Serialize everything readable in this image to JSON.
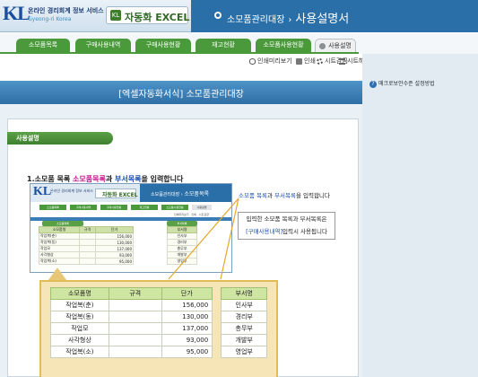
{
  "header": {
    "logo_mark": "KL",
    "logo_line1": "온라인 경리회계 정보 서비스",
    "logo_line2": "Gyeong-ri Korea",
    "product_name": "자동화 EXCEL",
    "breadcrumb_parent": "소모품관리대장",
    "breadcrumb_current": "사용설명서"
  },
  "tabs": [
    {
      "label": "소모품목록"
    },
    {
      "label": "구매사용내역"
    },
    {
      "label": "구매사용현황"
    },
    {
      "label": "재고현황"
    },
    {
      "label": "소모품사용현황"
    },
    {
      "label": "사용설명",
      "active": true
    }
  ],
  "toolbar": [
    {
      "label": "인쇄미리보기",
      "icon": "preview-icon"
    },
    {
      "label": "인쇄",
      "icon": "print-icon"
    },
    {
      "label": "시트감금",
      "icon": "lock-sheet-icon"
    },
    {
      "label": "시트해제",
      "icon": "unlock-sheet-icon"
    }
  ],
  "sidebar": {
    "help_label": "매크로보안수준 설정방법"
  },
  "banner": {
    "title": "[엑셀자동화서식] 소모품관리대장"
  },
  "section": {
    "title": "사용설명"
  },
  "step1": {
    "prefix": "1.소모품 목록",
    "pink": "소모품목록",
    "conj": "과",
    "blue": "부서목록",
    "suffix": "을 입력합니다"
  },
  "mini": {
    "logo_mark": "KL",
    "logo_text": "온라인 경리회계 정보 서비스",
    "product_name": "자동화 EXCEL",
    "breadcrumb_parent": "소모품관리대장",
    "breadcrumb_current": "소모품목록",
    "tabs": [
      "소모품목록",
      "구매사용내역",
      "구매사용현황",
      "재고현황",
      "소모품사용현황",
      "사용설명"
    ],
    "tools": "인쇄미리보기 · 인쇄 · 시트감금",
    "caption_left": "소모품목록",
    "caption_right": "부서목록",
    "headers": [
      "소모품명",
      "규격",
      "단가"
    ],
    "rows": [
      {
        "name": "작업복(춘)",
        "spec": "",
        "price": "156,000"
      },
      {
        "name": "작업복(동)",
        "spec": "",
        "price": "130,000"
      },
      {
        "name": "작업모",
        "spec": "",
        "price": "137,000"
      },
      {
        "name": "사각형상",
        "spec": "",
        "price": "93,000"
      },
      {
        "name": "작업복(소)",
        "spec": "",
        "price": "95,000"
      }
    ],
    "dept_header": "부서명",
    "depts": [
      "인사부",
      "경리부",
      "총무부",
      "개발부",
      "영업부"
    ]
  },
  "notes": {
    "note1_blue1": "소모품 목록",
    "note1_mid": "과 ",
    "note1_blue2": "부서목록",
    "note1_end": "을 입력합니다",
    "note2_line1": "입력한 소모품 목록과 부서목록은",
    "note2_line2_blue": "[구매사용내역]",
    "note2_line2_rest": "입력시 사용됩니다"
  },
  "zoom": {
    "headers": [
      "소모품명",
      "규격",
      "단가"
    ],
    "rows": [
      {
        "name": "작업복(춘)",
        "spec": "",
        "price": "156,000"
      },
      {
        "name": "작업복(동)",
        "spec": "",
        "price": "130,000"
      },
      {
        "name": "작업모",
        "spec": "",
        "price": "137,000"
      },
      {
        "name": "사각형상",
        "spec": "",
        "price": "93,000"
      },
      {
        "name": "작업복(소)",
        "spec": "",
        "price": "95,000"
      }
    ],
    "dept_header": "부서명",
    "depts": [
      "인사부",
      "경리부",
      "총무부",
      "개발부",
      "영업부"
    ]
  },
  "colors": {
    "brand_blue": "#2a6fa8",
    "tab_green": "#4a9a3b",
    "accent_pink": "#c8168f",
    "accent_blue": "#1e4fb4",
    "zoom_bg": "#f6e6b7"
  }
}
